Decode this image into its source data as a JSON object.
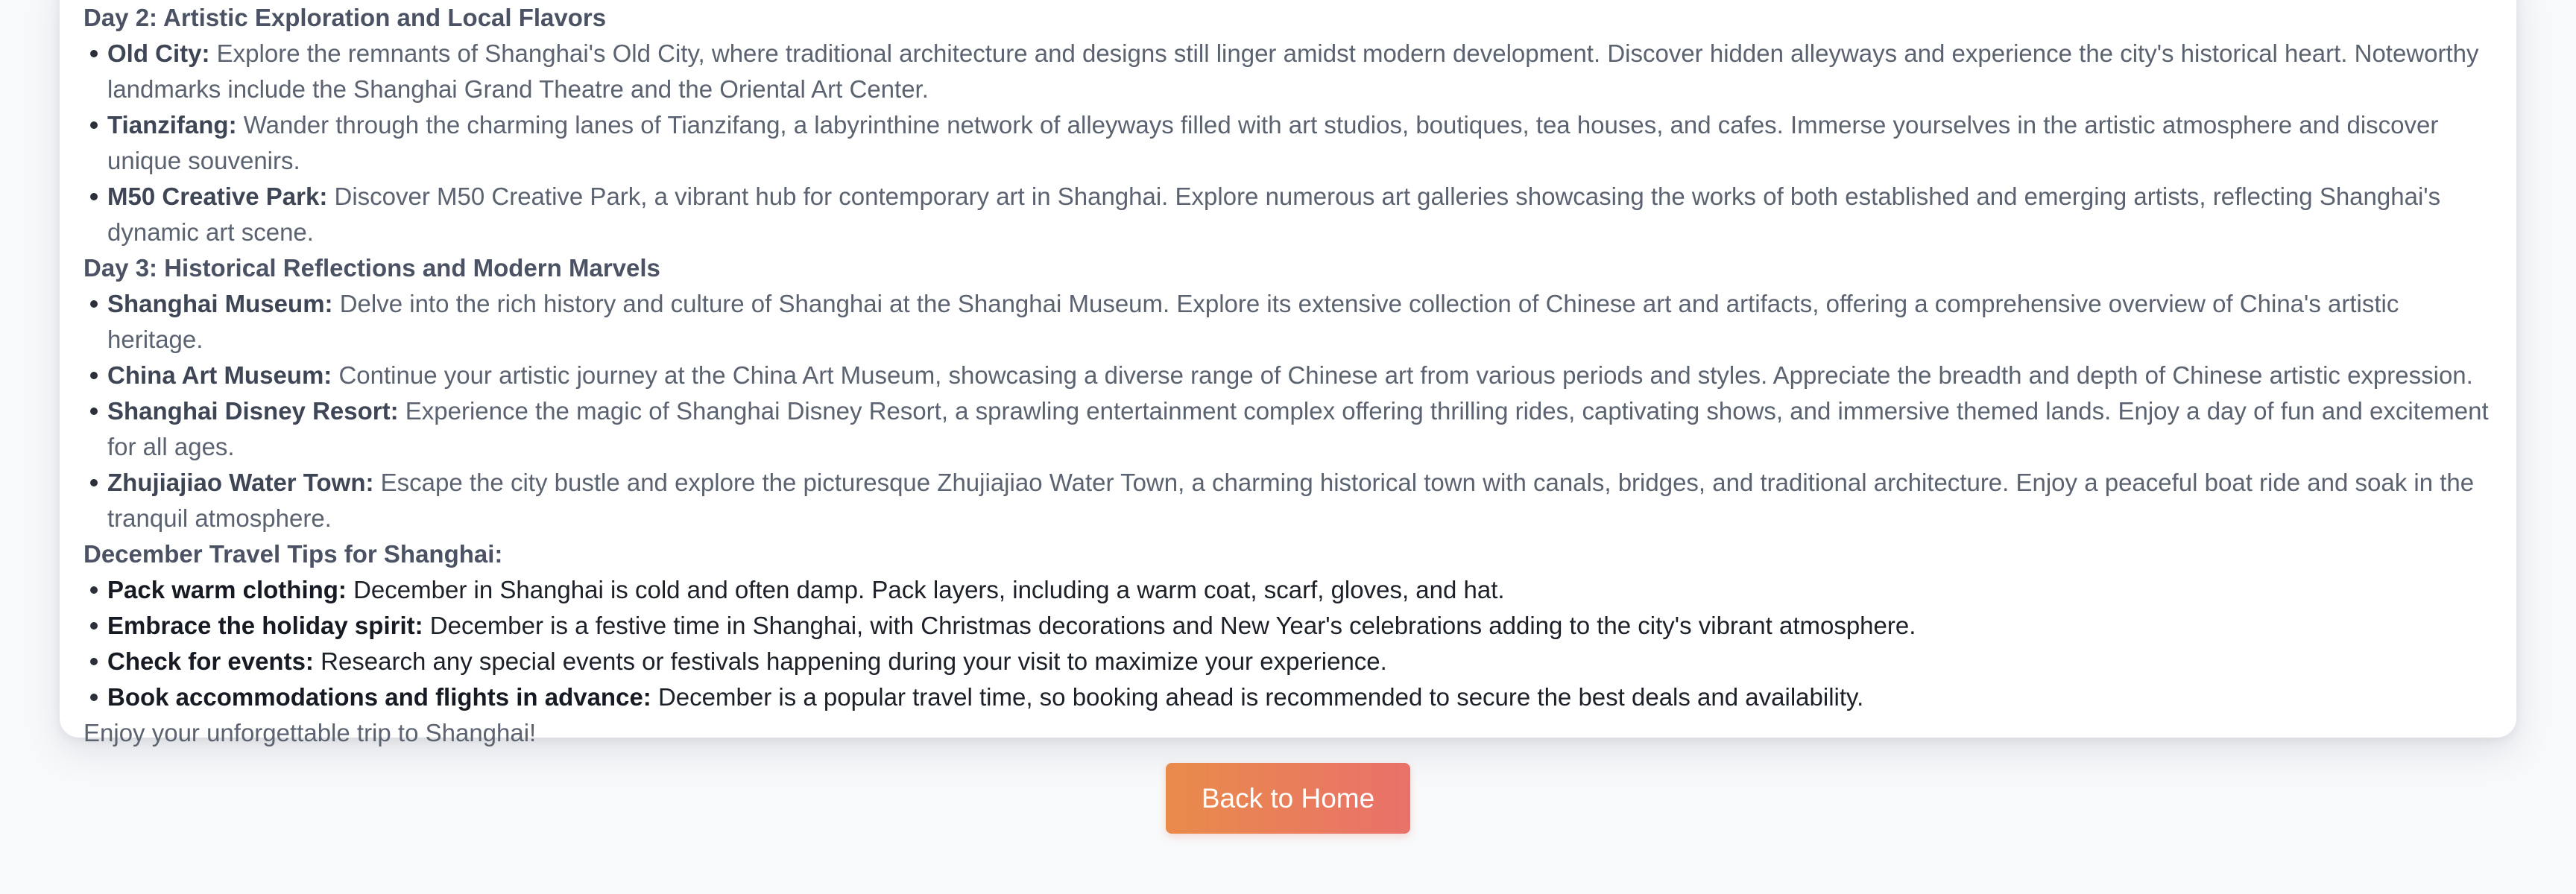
{
  "day2": {
    "heading": "Day 2: Artistic Exploration and Local Flavors",
    "items": [
      {
        "title": "Old City:",
        "text": " Explore the remnants of Shanghai's Old City, where traditional architecture and designs still linger amidst modern development. Discover hidden alleyways and experience the city's historical heart. Noteworthy landmarks include the Shanghai Grand Theatre and the Oriental Art Center."
      },
      {
        "title": "Tianzifang:",
        "text": " Wander through the charming lanes of Tianzifang, a labyrinthine network of alleyways filled with art studios, boutiques, tea houses, and cafes. Immerse yourselves in the artistic atmosphere and discover unique souvenirs."
      },
      {
        "title": "M50 Creative Park:",
        "text": " Discover M50 Creative Park, a vibrant hub for contemporary art in Shanghai. Explore numerous art galleries showcasing the works of both established and emerging artists, reflecting Shanghai's dynamic art scene."
      }
    ]
  },
  "day3": {
    "heading": "Day 3: Historical Reflections and Modern Marvels",
    "items": [
      {
        "title": "Shanghai Museum:",
        "text": " Delve into the rich history and culture of Shanghai at the Shanghai Museum. Explore its extensive collection of Chinese art and artifacts, offering a comprehensive overview of China's artistic heritage."
      },
      {
        "title": "China Art Museum:",
        "text": " Continue your artistic journey at the China Art Museum, showcasing a diverse range of Chinese art from various periods and styles. Appreciate the breadth and depth of Chinese artistic expression."
      },
      {
        "title": "Shanghai Disney Resort:",
        "text": " Experience the magic of Shanghai Disney Resort, a sprawling entertainment complex offering thrilling rides, captivating shows, and immersive themed lands. Enjoy a day of fun and excitement for all ages."
      },
      {
        "title": "Zhujiajiao Water Town:",
        "text": " Escape the city bustle and explore the picturesque Zhujiajiao Water Town, a charming historical town with canals, bridges, and traditional architecture. Enjoy a peaceful boat ride and soak in the tranquil atmosphere."
      }
    ]
  },
  "tips": {
    "heading": "December Travel Tips for Shanghai:",
    "items": [
      {
        "title": "Pack warm clothing:",
        "text": " December in Shanghai is cold and often damp. Pack layers, including a warm coat, scarf, gloves, and hat."
      },
      {
        "title": "Embrace the holiday spirit:",
        "text": " December is a festive time in Shanghai, with Christmas decorations and New Year's celebrations adding to the city's vibrant atmosphere."
      },
      {
        "title": "Check for events:",
        "text": " Research any special events or festivals happening during your visit to maximize your experience."
      },
      {
        "title": "Book accommodations and flights in advance:",
        "text": " December is a popular travel time, so booking ahead is recommended to secure the best deals and availability."
      }
    ]
  },
  "closing": "Enjoy your unforgettable trip to Shanghai!",
  "back_button": {
    "label": "Back to Home"
  },
  "colors": {
    "page_background": "#f8f9fb",
    "card_background": "#ffffff",
    "button_gradient_start": "#e98b4b",
    "button_gradient_end": "#e9716a"
  }
}
